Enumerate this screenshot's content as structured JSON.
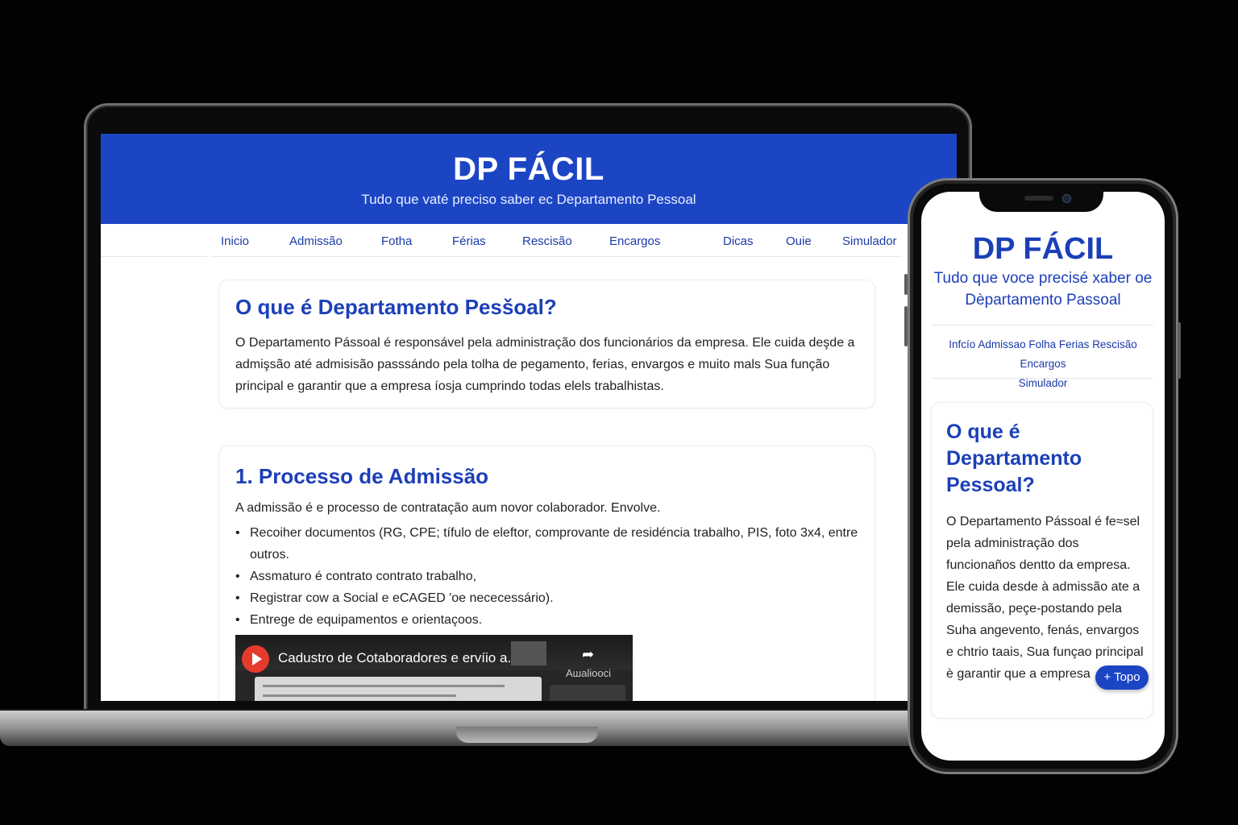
{
  "site": {
    "title": "DP FÁCIL",
    "subtitle_desktop": "Tudo que vaté preciso saber ec Departamento Pessoal",
    "subtitle_mobile": "Tudo que voce precisé xaber oe Dèpartamento Passoal"
  },
  "nav_desktop": [
    "Inicio",
    "Admissão",
    "Fotha",
    "Férias",
    "Rescisão",
    "Encargos",
    "Dicas",
    "Ouie",
    "Simulador"
  ],
  "nav_mobile": [
    "Infcío",
    "Admissao",
    "Folha",
    "Ferias",
    "Rescisão",
    "Encargos",
    "Simulador"
  ],
  "section_intro": {
    "heading_desktop": "O que é Departamento Pesšoal?",
    "heading_mobile": "O que é Departamento Pessoal?",
    "body_desktop": "O Departamento Pássoal é responsável pela administração dos funcionários da empresa. Ele cuida deşde a admişsão até admisisão passsándo pela tolha de pegamento, ferias, envargos e muito mals Sua função principal e garantir que a empresa íosja cumprindo todas elels trabalhistas.",
    "body_mobile": "O Departamento Pássoal é fe≈sel pela administração dos funcionaños dentto da empresa. Ele cuida desde à admissão ate a demissão, peçe-postando pela Suha angevento, fenás, envargos e chtrio taais, Sua funçao principal è garantir que a empresa"
  },
  "section_admissao": {
    "heading": "1. Processo de Admissão",
    "intro": "A admissão é e processo de contratação aum novor colaborador. Envolve.",
    "items": [
      "Recoiher documentos (RG, CPE; tífulo de eleftor, comprovante de residéncia trabalho, PIS, foto 3x4, entre outros.",
      "Assmaturo é contrato contrato trabalho,",
      "Registrar cow a Social e eCAGED 'oe nececessário).",
      "Entrege de equipamentos e orientaçoos."
    ]
  },
  "video": {
    "title": "Cadustro de Cotaboradores e ervíio a..",
    "watch_label": "Aшaliooci",
    "share_icon": "share-arrow-icon",
    "play_icon": "play-icon"
  },
  "mobile_top_button": "+ Topo",
  "colors": {
    "brand_blue": "#1c45c4",
    "heading_blue": "#1c3fb8",
    "link_blue": "#1a3aa8",
    "backdrop": "#020202"
  }
}
